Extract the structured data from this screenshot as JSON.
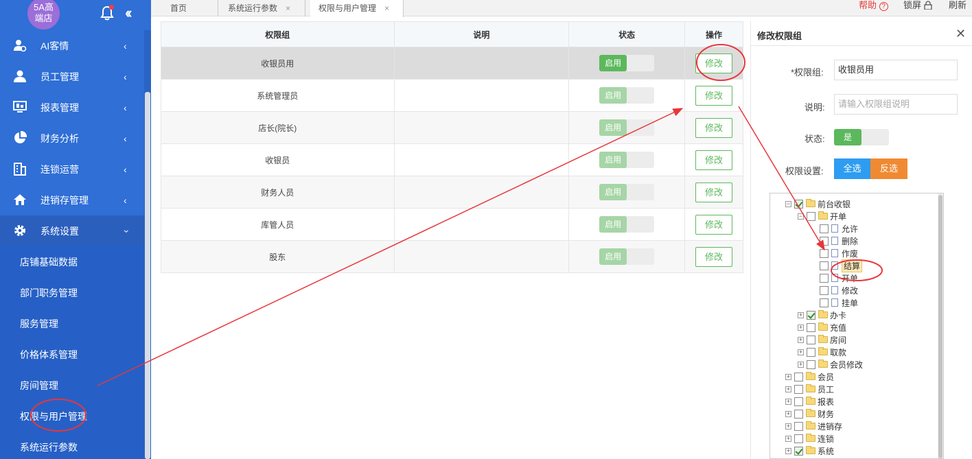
{
  "sidebar": {
    "store_name": "5A高端店",
    "store_name_line1": "5A高",
    "store_name_line2": "端店",
    "menu": [
      {
        "label": "AI客情",
        "icon": "user-chart-icon"
      },
      {
        "label": "员工管理",
        "icon": "person-icon"
      },
      {
        "label": "报表管理",
        "icon": "monitor-icon"
      },
      {
        "label": "财务分析",
        "icon": "pie-chart-icon"
      },
      {
        "label": "连锁运营",
        "icon": "building-icon"
      },
      {
        "label": "进销存管理",
        "icon": "house-icon"
      },
      {
        "label": "系统设置",
        "icon": "gear-icon"
      }
    ],
    "submenu": [
      "店铺基础数据",
      "部门职务管理",
      "服务管理",
      "价格体系管理",
      "房间管理",
      "权限与用户管理",
      "系统运行参数"
    ]
  },
  "tabs": [
    {
      "label": "首页"
    },
    {
      "label": "系统运行参数"
    },
    {
      "label": "权限与用户管理"
    }
  ],
  "top_actions": {
    "help": "帮助",
    "lock": "锁屏",
    "refresh": "刷新"
  },
  "table": {
    "headers": [
      "权限组",
      "说明",
      "状态",
      "操作"
    ],
    "rows": [
      {
        "group": "收银员用",
        "desc": "",
        "status": "启用",
        "action": "修改"
      },
      {
        "group": "系统管理员",
        "desc": "",
        "status": "启用",
        "action": "修改"
      },
      {
        "group": "店长(院长)",
        "desc": "",
        "status": "启用",
        "action": "修改"
      },
      {
        "group": "收银员",
        "desc": "",
        "status": "启用",
        "action": "修改"
      },
      {
        "group": "财务人员",
        "desc": "",
        "status": "启用",
        "action": "修改"
      },
      {
        "group": "库管人员",
        "desc": "",
        "status": "启用",
        "action": "修改"
      },
      {
        "group": "股东",
        "desc": "",
        "status": "启用",
        "action": "修改"
      }
    ]
  },
  "panel": {
    "title": "修改权限组",
    "group_label": "*权限组:",
    "group_value": "收银员用",
    "desc_label": "说明:",
    "desc_placeholder": "请输入权限组说明",
    "status_label": "状态:",
    "status_value": "是",
    "perm_label": "权限设置:",
    "select_all": "全选",
    "invert": "反选"
  },
  "tree": [
    {
      "label": "前台收银",
      "level": 0,
      "exp": "⊟",
      "checked": true,
      "type": "folder"
    },
    {
      "label": "开单",
      "level": 1,
      "exp": "⊟",
      "checked": false,
      "type": "folder"
    },
    {
      "label": "允许",
      "level": 2,
      "exp": "",
      "checked": false,
      "type": "doc"
    },
    {
      "label": "删除",
      "level": 2,
      "exp": "",
      "checked": false,
      "type": "doc"
    },
    {
      "label": "作废",
      "level": 2,
      "exp": "",
      "checked": false,
      "type": "doc"
    },
    {
      "label": "结算",
      "level": 2,
      "exp": "",
      "checked": false,
      "type": "doc",
      "highlight": true
    },
    {
      "label": "开单",
      "level": 2,
      "exp": "",
      "checked": false,
      "type": "doc"
    },
    {
      "label": "修改",
      "level": 2,
      "exp": "",
      "checked": false,
      "type": "doc"
    },
    {
      "label": "挂单",
      "level": 2,
      "exp": "",
      "checked": false,
      "type": "doc"
    },
    {
      "label": "办卡",
      "level": 1,
      "exp": "⊞",
      "checked": true,
      "type": "folder"
    },
    {
      "label": "充值",
      "level": 1,
      "exp": "⊞",
      "checked": false,
      "type": "folder"
    },
    {
      "label": "房间",
      "level": 1,
      "exp": "⊞",
      "checked": false,
      "type": "folder"
    },
    {
      "label": "取款",
      "level": 1,
      "exp": "⊞",
      "checked": false,
      "type": "folder"
    },
    {
      "label": "会员修改",
      "level": 1,
      "exp": "⊞",
      "checked": false,
      "type": "folder"
    },
    {
      "label": "会员",
      "level": 0,
      "exp": "⊞",
      "checked": false,
      "type": "folder"
    },
    {
      "label": "员工",
      "level": 0,
      "exp": "⊞",
      "checked": false,
      "type": "folder"
    },
    {
      "label": "报表",
      "level": 0,
      "exp": "⊞",
      "checked": false,
      "type": "folder"
    },
    {
      "label": "财务",
      "level": 0,
      "exp": "⊞",
      "checked": false,
      "type": "folder"
    },
    {
      "label": "进销存",
      "level": 0,
      "exp": "⊞",
      "checked": false,
      "type": "folder"
    },
    {
      "label": "连锁",
      "level": 0,
      "exp": "⊞",
      "checked": false,
      "type": "folder"
    },
    {
      "label": "系统",
      "level": 0,
      "exp": "⊞",
      "checked": true,
      "type": "folder"
    }
  ],
  "colors": {
    "sidebar": "#2f6fd6",
    "accent_green": "#5cb85c",
    "select_all": "#2e9cf0",
    "invert": "#f08a32",
    "annotation_red": "#e8363a"
  }
}
